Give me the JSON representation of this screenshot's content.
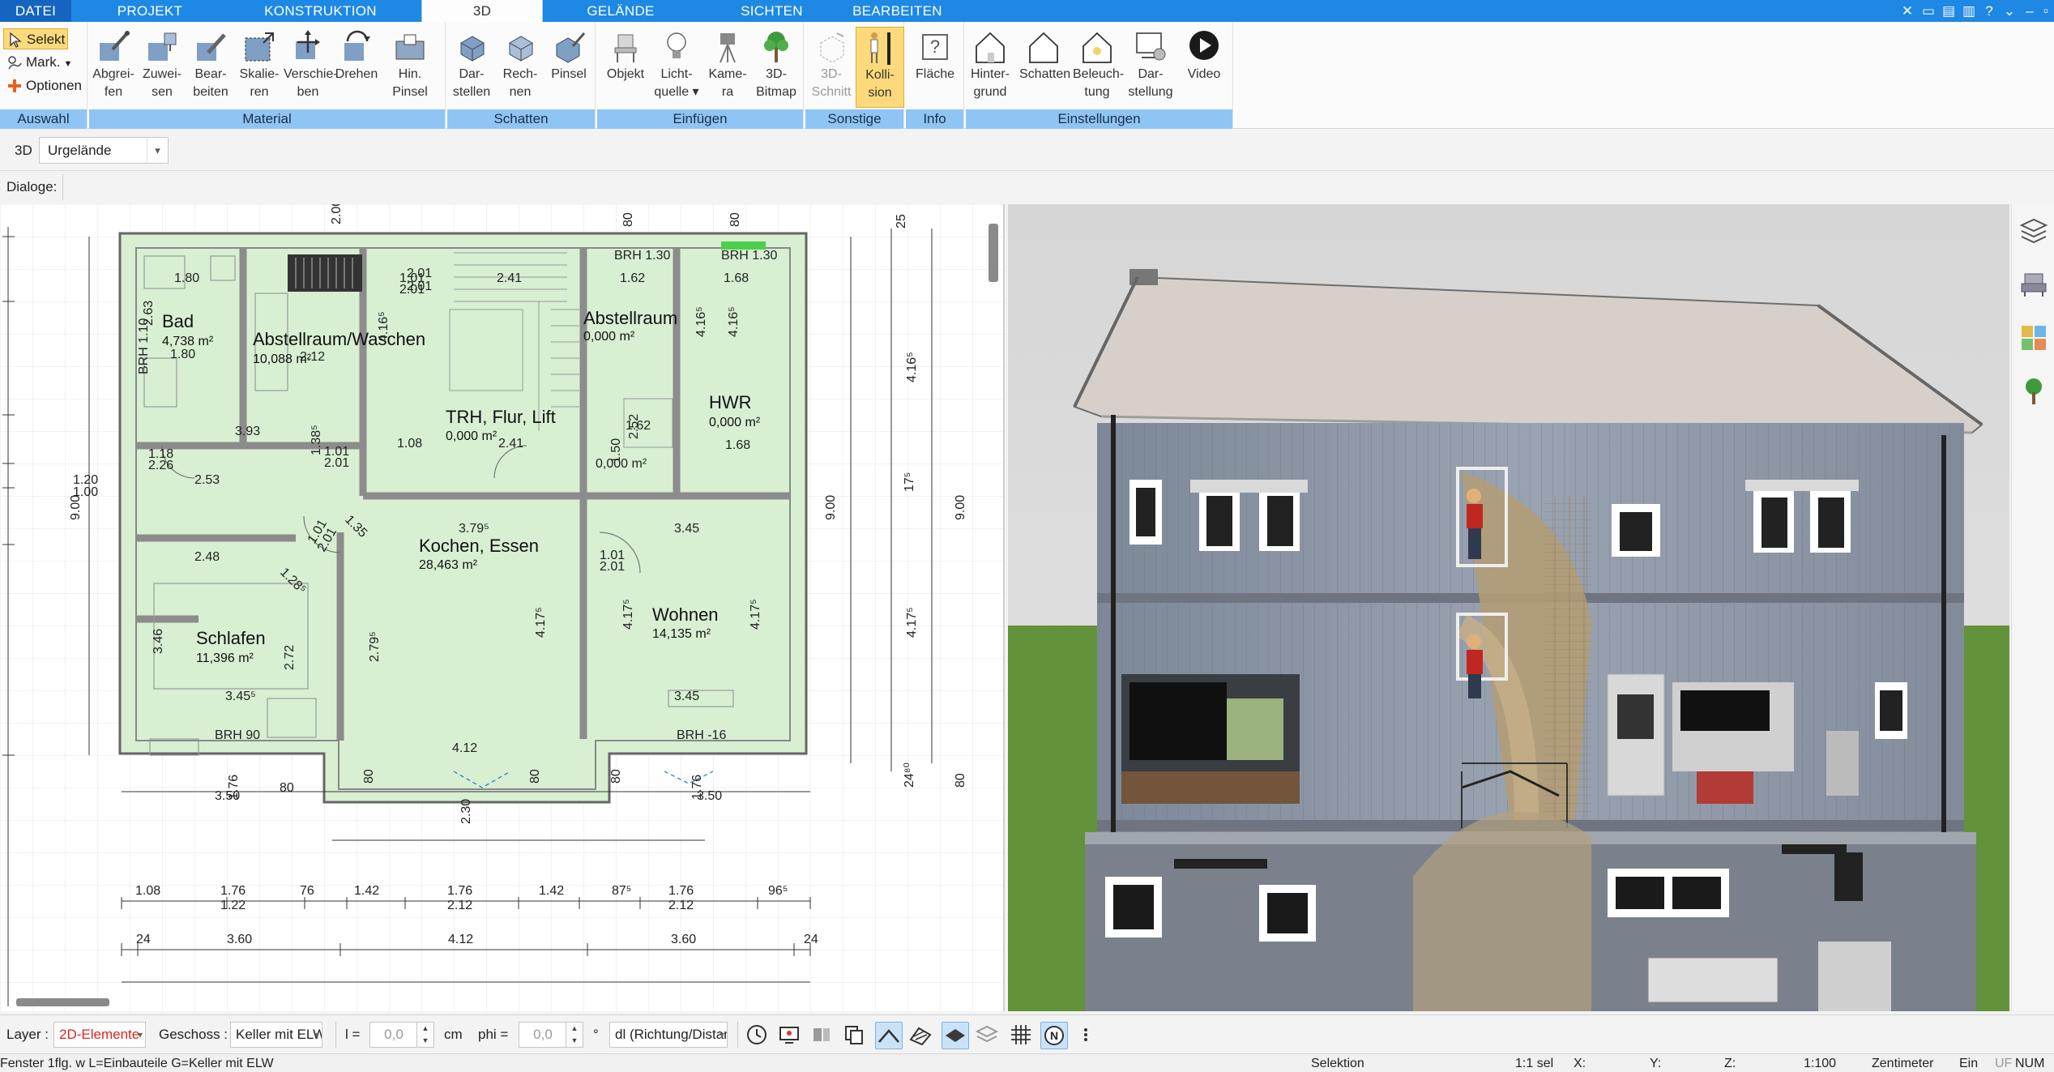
{
  "tabs": [
    {
      "label": "DATEI"
    },
    {
      "label": "PROJEKT"
    },
    {
      "label": "KONSTRUKTION"
    },
    {
      "label": "3D"
    },
    {
      "label": "GELÄNDE"
    },
    {
      "label": "SICHTEN"
    },
    {
      "label": "BEARBEITEN"
    }
  ],
  "colors": {
    "tab_bar": "#1e88e5",
    "group_title": "#8ec5f4",
    "active_button": "#fcd97a",
    "plan_fill": "#d8efd2",
    "plan_wall": "#777777",
    "sky": "#dcdcdc",
    "grass": "#62923a"
  },
  "ribbon": {
    "auswahl": {
      "items": [
        {
          "label": "Selekt",
          "icon": "cursor-icon"
        },
        {
          "label": "Mark.",
          "icon": "mark-icon"
        },
        {
          "label": "Optionen",
          "icon": "plus-icon"
        }
      ],
      "title": "Auswahl"
    },
    "material": {
      "buttons": [
        {
          "l1": "Abgrei-",
          "l2": "fen",
          "icon": "pipette-icon"
        },
        {
          "l1": "Zuwei-",
          "l2": "sen",
          "icon": "assign-icon"
        },
        {
          "l1": "Bear-",
          "l2": "beiten",
          "icon": "edit-material-icon"
        },
        {
          "l1": "Skalie-",
          "l2": "ren",
          "icon": "scale-icon"
        },
        {
          "l1": "Verschie-",
          "l2": "ben",
          "icon": "move-icon"
        },
        {
          "l1": "Drehen",
          "l2": "",
          "icon": "rotate-icon"
        },
        {
          "l1": "Hin.",
          "l2": "Pinsel",
          "icon": "background-brush-icon"
        }
      ],
      "title": "Material"
    },
    "schatten": {
      "buttons": [
        {
          "l1": "Dar-",
          "l2": "stellen",
          "icon": "show-shadow-icon"
        },
        {
          "l1": "Rech-",
          "l2": "nen",
          "icon": "calculate-shadow-icon"
        },
        {
          "l1": "Pinsel",
          "l2": "",
          "icon": "shadow-brush-icon"
        }
      ],
      "title": "Schatten"
    },
    "einfuegen": {
      "buttons": [
        {
          "l1": "Objekt",
          "l2": "",
          "icon": "chair-icon"
        },
        {
          "l1": "Licht-",
          "l2": "quelle",
          "icon": "lightbulb-icon"
        },
        {
          "l1": "Kame-",
          "l2": "ra",
          "icon": "camera-icon"
        },
        {
          "l1": "3D-",
          "l2": "Bitmap",
          "icon": "tree-icon"
        }
      ],
      "title": "Einfügen"
    },
    "sonstige": {
      "buttons": [
        {
          "l1": "3D-",
          "l2": "Schnitt",
          "icon": "section-icon"
        },
        {
          "l1": "Kolli-",
          "l2": "sion",
          "icon": "collision-icon"
        }
      ],
      "title": "Sonstige"
    },
    "info": {
      "buttons": [
        {
          "l1": "Fläche",
          "l2": "",
          "icon": "area-info-icon"
        }
      ],
      "title": "Info"
    },
    "einstellungen": {
      "buttons": [
        {
          "l1": "Hinter-",
          "l2": "grund",
          "icon": "background-house-icon"
        },
        {
          "l1": "Schatten",
          "l2": "",
          "icon": "shadow-house-icon"
        },
        {
          "l1": "Beleuch-",
          "l2": "tung",
          "icon": "lighting-house-icon"
        },
        {
          "l1": "Dar-",
          "l2": "stellung",
          "icon": "display-settings-icon"
        },
        {
          "l1": "Video",
          "l2": "",
          "icon": "play-icon"
        }
      ],
      "title": "Einstellungen"
    }
  },
  "toolbar2": {
    "mode": "3D",
    "terrain": "Urgelände",
    "dialoge": "Dialoge:"
  },
  "plan": {
    "rooms": [
      {
        "name": "Bad",
        "area": "4,738 m²"
      },
      {
        "name": "Abstellraum/Waschen",
        "area": "10,088 m²"
      },
      {
        "name": "Abstellraum",
        "area": "0,000 m²"
      },
      {
        "name": "HWR",
        "area": "0,000 m²"
      },
      {
        "name": "TRH, Flur, Lift",
        "area": "0,000 m²"
      },
      {
        "name": "Kochen, Essen",
        "area": "28,463 m²"
      },
      {
        "name": "Wohnen",
        "area": "14,135 m²"
      },
      {
        "name": "Schlafen",
        "area": "11,396 m²"
      }
    ],
    "dims": [
      "1.80",
      "2.63",
      "1.80",
      "2.12",
      "4.16⁵",
      "2.41",
      "1.01",
      "2.01",
      "1.62",
      "1.68",
      "4.16⁵",
      "4.16⁵",
      "1.68",
      "3.93",
      "1.38⁵",
      "1.08",
      "2.41",
      "1.01",
      "2.01",
      "1.62",
      "1.50",
      "2.52",
      "0,000 m²",
      "1.18",
      "2.26",
      "2.53",
      "3.79⁵",
      "3.45",
      "1.35",
      "2.48",
      "1.01",
      "2.01",
      "1.01",
      "2.01",
      "1.28⁵",
      "3.46",
      "2.72",
      "2.79⁵",
      "4.17⁵",
      "4.17⁵",
      "4.17⁵",
      "3.45⁵",
      "3.45",
      "4.12",
      "80",
      "80",
      "80",
      "1.76",
      "3.50",
      "3.50",
      "80",
      "1.76",
      "2.30",
      "1.20",
      "1.00",
      "9.00",
      "9.00",
      "9.00",
      "4.16⁵",
      "17⁵",
      "4.17⁵",
      "24⁸⁰",
      "80",
      "25",
      "BRH 1.30",
      "BRH 1.30",
      "BRH 90",
      "BRH -16",
      "BRH 1.10",
      "1.08",
      "1.76",
      "1.22",
      "76",
      "1.42",
      "1.76",
      "2.12",
      "1.42",
      "87⁵",
      "1.76",
      "2.12",
      "96⁵",
      "24",
      "3.60",
      "4.12",
      "3.60",
      "24",
      "2.00",
      "2.01",
      "2.01",
      "80",
      "80"
    ]
  },
  "inputbar": {
    "layer_label": "Layer :",
    "layer_value": "2D-Elemente",
    "geschoss_label": "Geschoss :",
    "geschoss_value": "Keller mit ELW",
    "l_label": "l =",
    "l_value": "0,0",
    "l_unit": "cm",
    "phi_label": "phi =",
    "phi_value": "0,0",
    "phi_unit": "°",
    "dl_value": "dl (Richtung/Distanz)"
  },
  "statusbar": {
    "hint": "Fenster 1flg. w L=Einbauteile G=Keller mit ELW",
    "mode": "Selektion",
    "scale_sel": "1:1 sel",
    "x": "X:",
    "y": "Y:",
    "z": "Z:",
    "scale": "1:100",
    "unit": "Zentimeter",
    "ein": "Ein",
    "uf": "UF",
    "num": "NUM"
  }
}
